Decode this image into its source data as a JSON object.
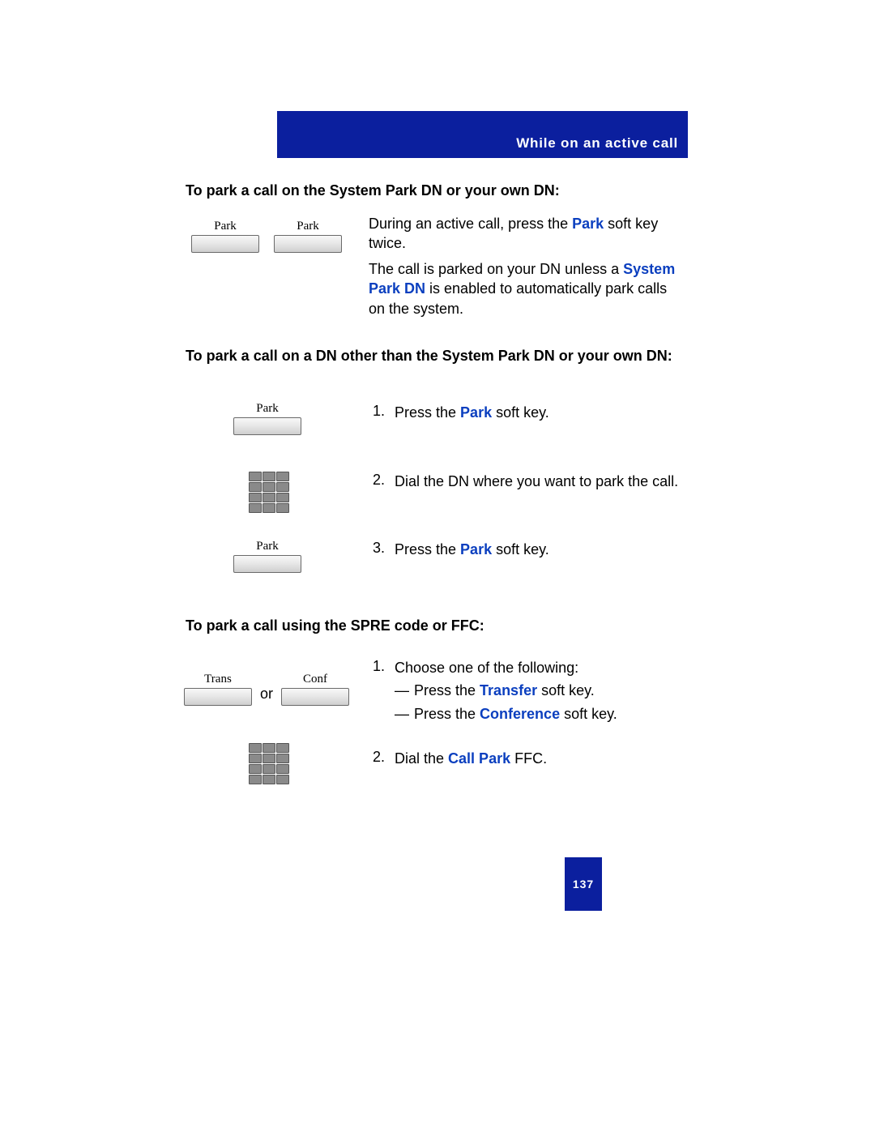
{
  "header": {
    "section_title": "While on an active call"
  },
  "headings": {
    "park_system": "To park a call on the System Park DN or your own DN:",
    "park_other": "To park a call on a DN other than the System Park DN or your own DN:",
    "park_spre": "To park a call using the SPRE code or FFC:"
  },
  "softkeys": {
    "park": "Park",
    "trans": "Trans",
    "conf": "Conf"
  },
  "labels": {
    "or": "or"
  },
  "text": {
    "section1": {
      "line1_pre": "During an active call, press the ",
      "link_park": "Park",
      "line1_post": " soft key twice.",
      "line2_pre": "The call is parked on your DN unless a ",
      "link_spdn": "System Park DN",
      "line2_post": " is enabled to automatically park calls on the system."
    },
    "section2": {
      "step1_pre": "Press the ",
      "step1_link": "Park",
      "step1_post": " soft key.",
      "step2": "Dial the DN where you want to park the call.",
      "step3_pre": "Press the ",
      "step3_link": "Park",
      "step3_post": " soft key."
    },
    "section3": {
      "step1_intro": "Choose one of the following:",
      "step1a_pre": "Press the ",
      "step1a_link": "Transfer",
      "step1a_post": " soft key.",
      "step1b_pre": "Press the ",
      "step1b_link": "Conference",
      "step1b_post": " soft key.",
      "step2_pre": "Dial the ",
      "step2_link": "Call Park",
      "step2_post": " FFC."
    }
  },
  "steps": {
    "n1": "1.",
    "n2": "2.",
    "n3": "3."
  },
  "page_number": "137"
}
